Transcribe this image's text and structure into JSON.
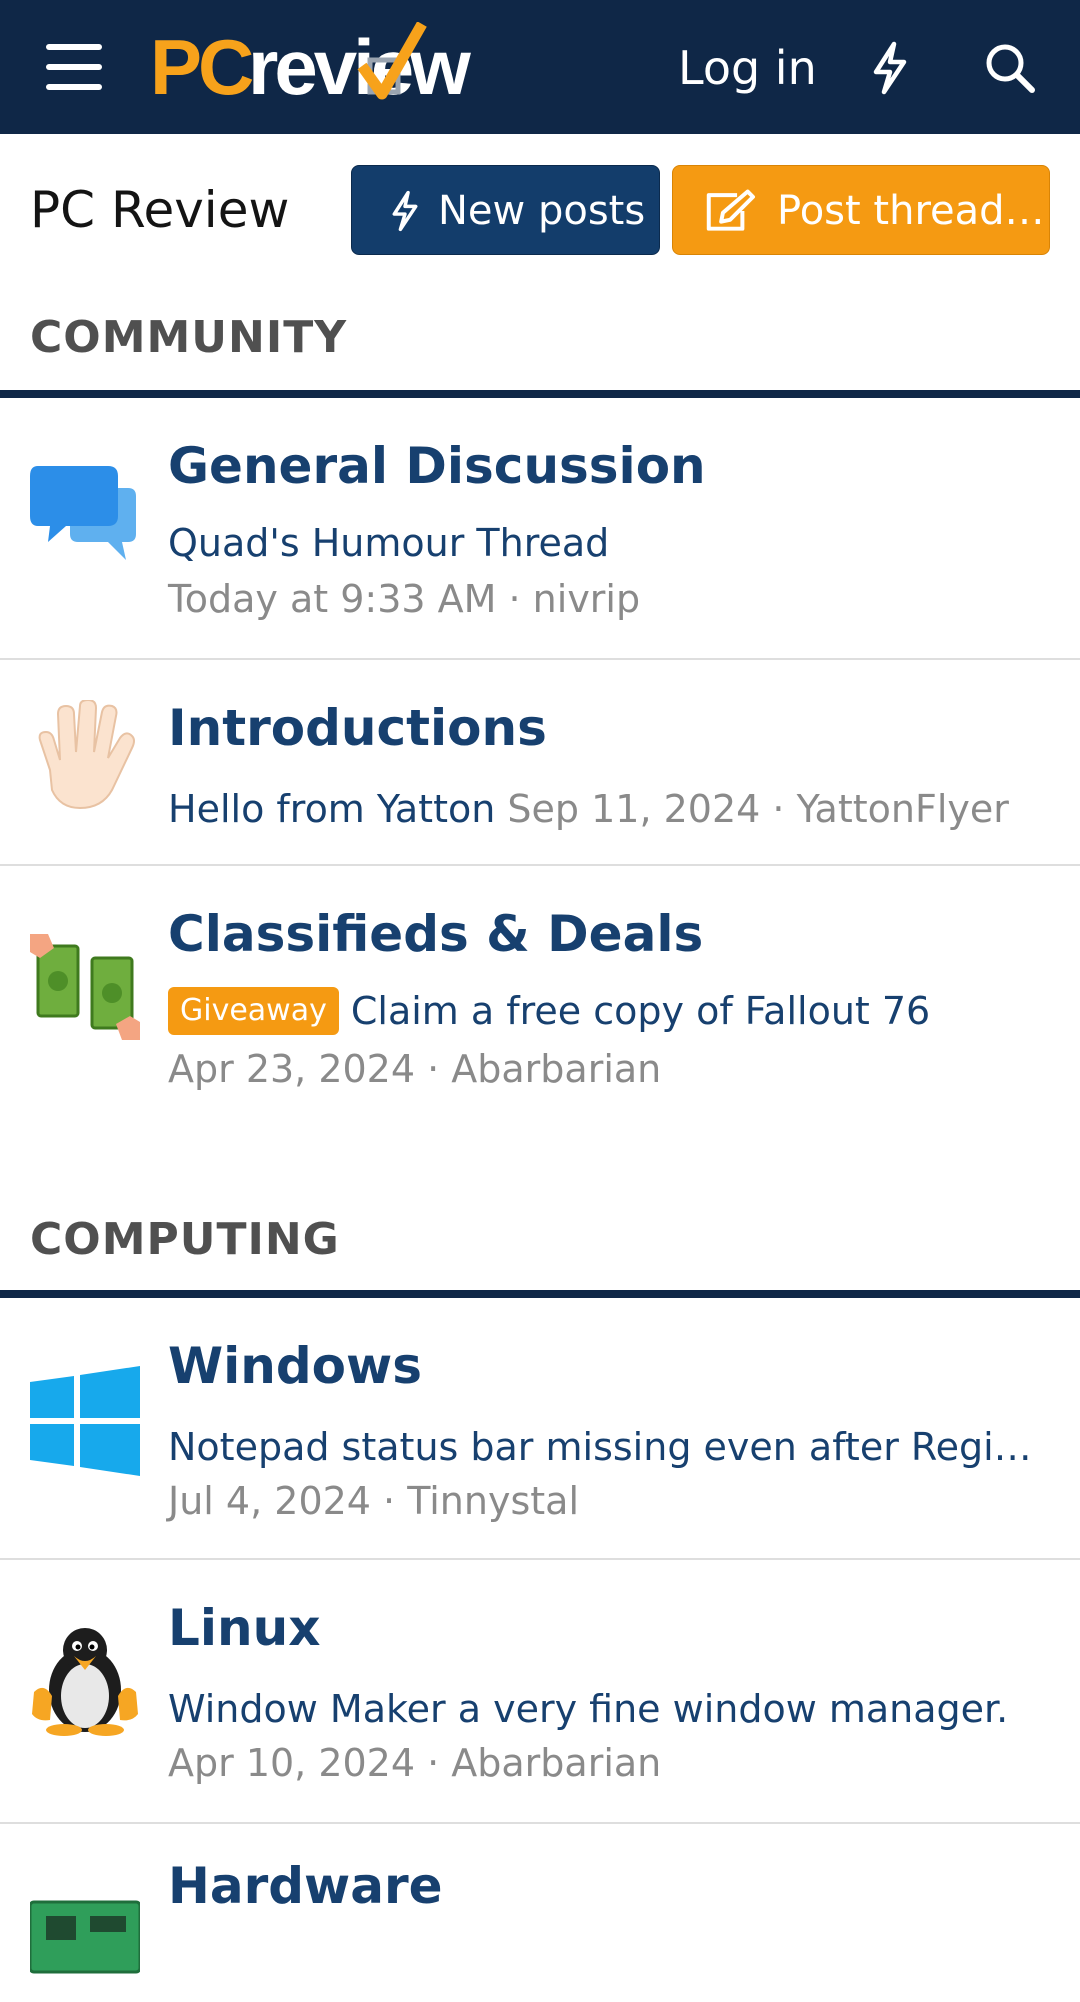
{
  "header": {
    "logo_pc": "PC",
    "logo_rest": "review",
    "login_label": "Log in",
    "icons": [
      "menu-icon",
      "lightning-icon",
      "search-icon"
    ]
  },
  "title_bar": {
    "title": "PC Review",
    "new_posts_label": "New posts",
    "post_thread_label": "Post thread…"
  },
  "colors": {
    "header_bg": "#0f2747",
    "accent_orange": "#f59a12",
    "button_blue": "#133d6b",
    "link_blue": "#17406f",
    "meta_gray": "#8a8a8a"
  },
  "sections": [
    {
      "title": "COMMUNITY",
      "forums": [
        {
          "title": "General Discussion",
          "icon": "speech-bubbles-icon",
          "last_thread": "Quad's Humour Thread",
          "meta": "Today at 9:33 AM · nivrip"
        },
        {
          "title": "Introductions",
          "icon": "waving-hand-icon",
          "last_thread": "Hello from Yatton",
          "meta": "Sep 11, 2024 · YattonFlyer"
        },
        {
          "title": "Classifieds & Deals",
          "icon": "money-exchange-icon",
          "prefix": "Giveaway",
          "last_thread": "Claim a free copy of Fallout 76",
          "meta": "Apr 23, 2024 · Abarbarian"
        }
      ]
    },
    {
      "title": "COMPUTING",
      "forums": [
        {
          "title": "Windows",
          "icon": "windows-logo-icon",
          "last_thread": "Notepad status bar missing even after Registry…",
          "meta": "Jul 4, 2024 · Tinnystal"
        },
        {
          "title": "Linux",
          "icon": "linux-penguin-icon",
          "last_thread": "Window Maker a very fine window manager.",
          "meta": "Apr 10, 2024 · Abarbarian"
        },
        {
          "title": "Hardware",
          "icon": "circuit-board-icon"
        }
      ]
    }
  ]
}
